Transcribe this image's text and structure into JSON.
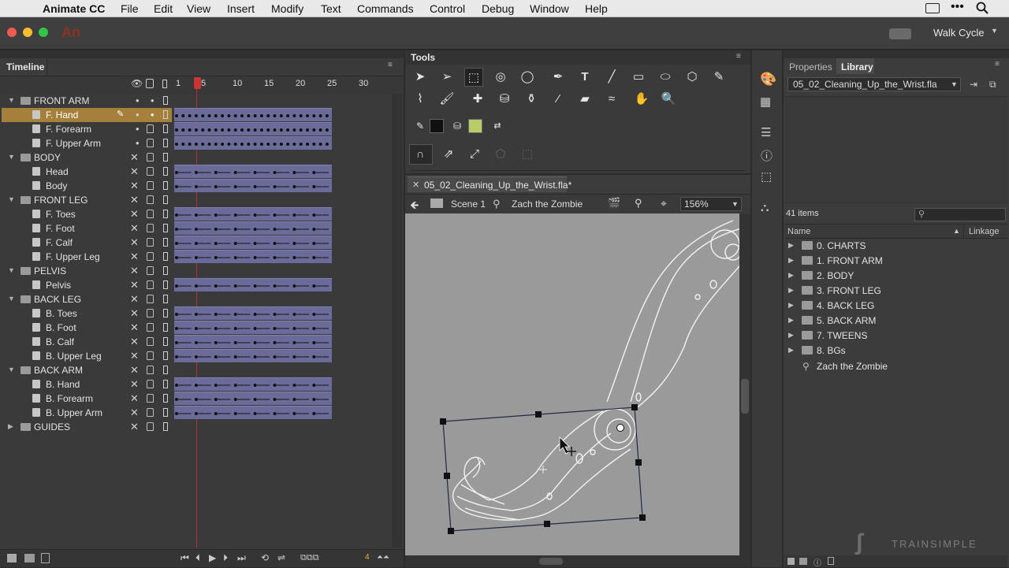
{
  "menubar": {
    "app": "Animate CC",
    "items": [
      "File",
      "Edit",
      "View",
      "Insert",
      "Modify",
      "Text",
      "Commands",
      "Control",
      "Debug",
      "Window",
      "Help"
    ]
  },
  "appbar": {
    "logo": "An",
    "workspace": "Walk Cycle"
  },
  "timeline": {
    "title": "Timeline",
    "ruler": [
      "1",
      "5",
      "10",
      "15",
      "20",
      "25",
      "30"
    ],
    "playhead_frame": "5",
    "layers": [
      {
        "name": "FRONT ARM",
        "type": "folder"
      },
      {
        "name": "F. Hand",
        "type": "layer",
        "selected": true
      },
      {
        "name": "F. Forearm",
        "type": "layer"
      },
      {
        "name": "F. Upper Arm",
        "type": "layer"
      },
      {
        "name": "BODY",
        "type": "folder"
      },
      {
        "name": "Head",
        "type": "layer"
      },
      {
        "name": "Body",
        "type": "layer"
      },
      {
        "name": "FRONT LEG",
        "type": "folder"
      },
      {
        "name": "F. Toes",
        "type": "layer"
      },
      {
        "name": "F. Foot",
        "type": "layer"
      },
      {
        "name": "F. Calf",
        "type": "layer"
      },
      {
        "name": "F. Upper Leg",
        "type": "layer"
      },
      {
        "name": "PELVIS",
        "type": "folder"
      },
      {
        "name": "Pelvis",
        "type": "layer"
      },
      {
        "name": "BACK LEG",
        "type": "folder"
      },
      {
        "name": "B. Toes",
        "type": "layer"
      },
      {
        "name": "B. Foot",
        "type": "layer"
      },
      {
        "name": "B. Calf",
        "type": "layer"
      },
      {
        "name": "B. Upper Leg",
        "type": "layer"
      },
      {
        "name": "BACK ARM",
        "type": "folder"
      },
      {
        "name": "B. Hand",
        "type": "layer"
      },
      {
        "name": "B. Forearm",
        "type": "layer"
      },
      {
        "name": "B. Upper Arm",
        "type": "layer"
      },
      {
        "name": "GUIDES",
        "type": "folder",
        "collapsed": true
      }
    ],
    "footer_frame": "4"
  },
  "tools": {
    "title": "Tools"
  },
  "document": {
    "tab": "05_02_Cleaning_Up_the_Wrist.fla*",
    "scene": "Scene 1",
    "symbol": "Zach the Zombie",
    "zoom": "156%"
  },
  "properties_tab": "Properties",
  "library": {
    "tab": "Library",
    "file": "05_02_Cleaning_Up_the_Wrist.fla",
    "count": "41 items",
    "col_name": "Name",
    "col_linkage": "Linkage",
    "items": [
      "0. CHARTS",
      "1. FRONT ARM",
      "2. BODY",
      "3. FRONT LEG",
      "4. BACK LEG",
      "5. BACK ARM",
      "7. TWEENS",
      "8. BGs"
    ],
    "symbol_item": "Zach the Zombie"
  },
  "watermark": "TRAINSIMPLE",
  "colors": {
    "accent_red": "#e8412b",
    "selected_row": "#a5803a",
    "frames": "#6b6b9a",
    "fill": "#b9cc6a"
  }
}
